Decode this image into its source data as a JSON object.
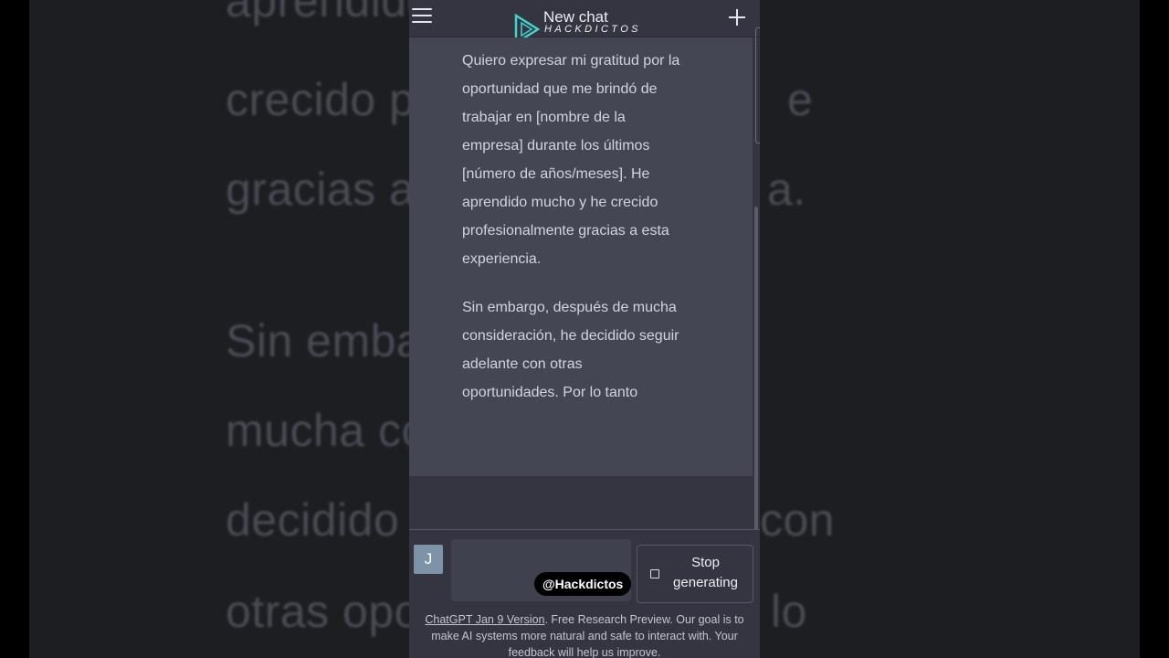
{
  "background": {
    "lines": [
      {
        "left": "aprendido",
        "right": ""
      },
      {
        "left": "crecido p",
        "right": "e"
      },
      {
        "left": "gracias a",
        "right": "a."
      },
      {
        "left": "Sin emba",
        "right": ""
      },
      {
        "left": "mucha co",
        "right": ""
      },
      {
        "left": "decidido",
        "right": "con"
      },
      {
        "left": "otras opo",
        "right": "lo"
      }
    ]
  },
  "header": {
    "title": "New chat",
    "logo_text": "HACKDICTOS",
    "menu_icon": "hamburger-menu-icon",
    "new_chat_icon": "plus-icon"
  },
  "message": {
    "paragraphs": [
      "Quiero expresar mi gratitud por la oportunidad que me brindó de trabajar en [nombre de la empresa] durante los últimos [número de años/meses]. He aprendido mucho y he crecido profesionalmente gracias a esta experiencia.",
      "Sin embargo, después de mucha consideración, he decidido seguir adelante con otras oportunidades. Por lo tanto"
    ]
  },
  "composer": {
    "avatar_letter": "J",
    "input_value": "",
    "stop_label": "Stop generating",
    "stop_icon": "stop-square-icon"
  },
  "watermark": "@Hackdictos",
  "footer": {
    "link": "ChatGPT Jan 9 Version",
    "text": ". Free Research Preview. Our goal is to make AI systems more natural and safe to interact with. Your feedback will help us improve."
  },
  "colors": {
    "message_bg": "#444654",
    "app_bg": "#343541",
    "accent": "#7d93a6"
  }
}
